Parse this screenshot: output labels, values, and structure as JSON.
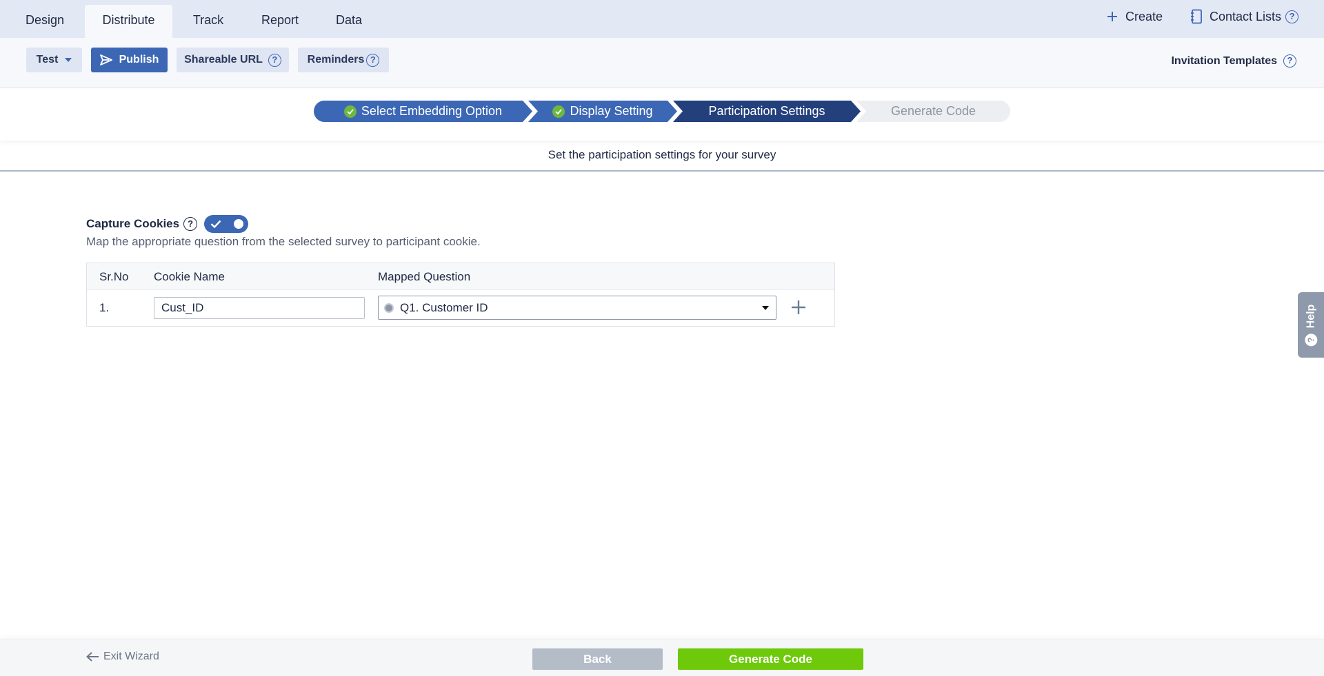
{
  "top_tabs": [
    {
      "label": "Design",
      "active": false
    },
    {
      "label": "Distribute",
      "active": true
    },
    {
      "label": "Track",
      "active": false
    },
    {
      "label": "Report",
      "active": false
    },
    {
      "label": "Data",
      "active": false
    }
  ],
  "top_right": {
    "create_label": "Create",
    "contact_lists_label": "Contact Lists"
  },
  "toolbar": {
    "test_label": "Test",
    "publish_label": "Publish",
    "shareable_url_label": "Shareable URL",
    "reminders_label": "Reminders",
    "invitation_templates_label": "Invitation Templates"
  },
  "stepper": {
    "steps": [
      {
        "label": "Select Embedding Option",
        "state": "completed"
      },
      {
        "label": "Display Setting",
        "state": "completed"
      },
      {
        "label": "Participation Settings",
        "state": "current"
      },
      {
        "label": "Generate Code",
        "state": "pending"
      }
    ]
  },
  "subtitle": "Set the participation settings for your survey",
  "capture_cookies": {
    "label": "Capture Cookies",
    "enabled": true,
    "description": "Map the appropriate question from the selected survey to participant cookie."
  },
  "cookie_table": {
    "headers": {
      "sr_no": "Sr.No",
      "cookie_name": "Cookie Name",
      "mapped_question": "Mapped Question"
    },
    "rows": [
      {
        "sr_no": "1.",
        "cookie_name": "Cust_ID",
        "mapped_question": "Q1. Customer ID"
      }
    ]
  },
  "help_tab": {
    "label": "Help"
  },
  "footer": {
    "exit_wizard_label": "Exit Wizard",
    "back_label": "Back",
    "generate_code_label": "Generate Code"
  },
  "colors": {
    "accent": "#3c67b5",
    "step_completed": "#3c67b5",
    "step_current": "#233f7c",
    "step_pending": "#eceef2",
    "generate_button": "#6dc909",
    "back_button": "#b4bcc8",
    "check_green": "#6fb83f"
  },
  "icons": {
    "create": "plus-icon",
    "contact_lists": "notebook-icon",
    "publish": "send-icon",
    "help": "question-circle-icon",
    "add_row": "plus-icon",
    "exit": "arrow-left-icon"
  }
}
